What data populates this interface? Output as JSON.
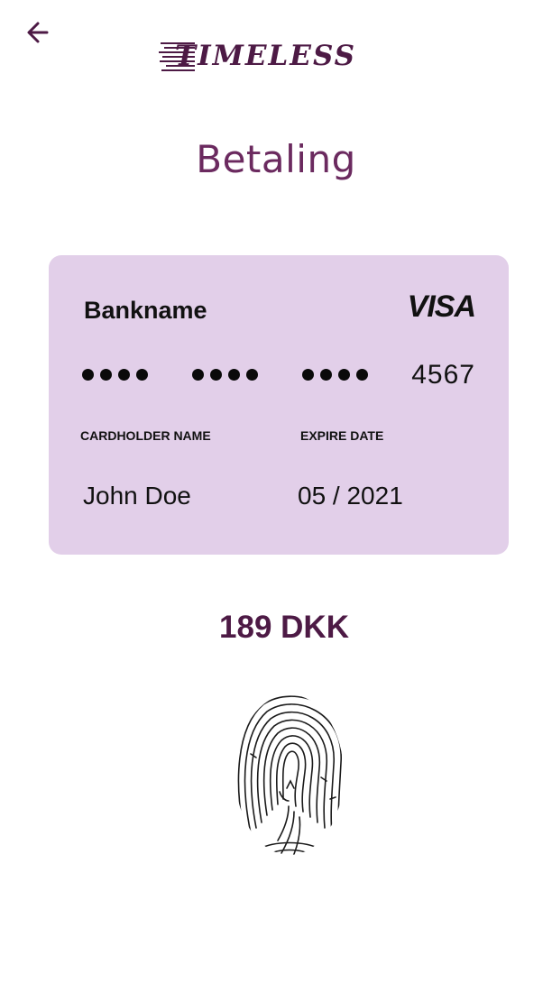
{
  "header": {
    "back_icon": "arrow-left-icon",
    "logo_text": "TIMELESS"
  },
  "page": {
    "title": "Betaling"
  },
  "card": {
    "bank_name": "Bankname",
    "network": "VISA",
    "masked_group": "••••",
    "last_digits": "4567",
    "cardholder_label": "CARDHOLDER NAME",
    "cardholder_value": "John Doe",
    "expire_label": "EXPIRE DATE",
    "expire_value": "05 / 2021",
    "background_color": "#e2cfe9"
  },
  "payment": {
    "amount": "189 DKK",
    "fingerprint_icon": "fingerprint-icon"
  },
  "colors": {
    "brand": "#4d1a45",
    "title": "#6b2a5f",
    "card_bg": "#e2cfe9"
  }
}
